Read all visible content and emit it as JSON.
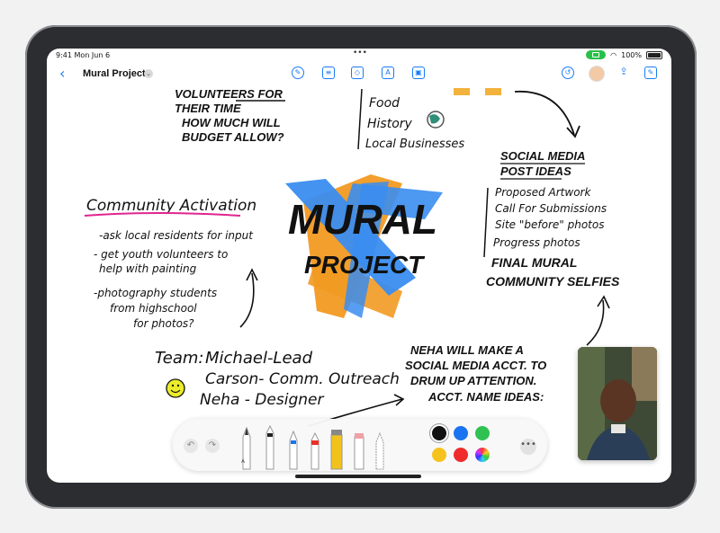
{
  "status_bar": {
    "time": "9:41",
    "date": "Mon Jun 6",
    "battery": "100%"
  },
  "toolbar": {
    "title": "Mural Project",
    "back_glyph": "‹",
    "chevron_glyph": "⌄",
    "more_dots": "•••"
  },
  "notes": {
    "volunteers": [
      "VOLUNTEERS FOR",
      "THEIR TIME",
      "HOW MUCH WILL",
      "BUDGET ALLOW?"
    ],
    "list_top": [
      "Food",
      "History",
      "Local Businesses"
    ],
    "community_heading": "Community Activation",
    "community_items": [
      "-ask local residents for input",
      "- get youth volunteers to",
      "help with painting",
      "-photography students",
      "from highschool",
      "for photos?"
    ],
    "mural_title": [
      "MURAL",
      "PROJECT"
    ],
    "social_heading": [
      "SOCIAL MEDIA",
      "POST IDEAS"
    ],
    "social_items": [
      "Proposed Artwork",
      "Call For Submissions",
      "Site \"before\" photos",
      "Progress photos"
    ],
    "social_bold": [
      "FINAL MURAL",
      "COMMUNITY SELFIES"
    ],
    "team_heading": "Team:",
    "team_items": [
      "Michael-Lead",
      "Carson- Comm. Outreach",
      "Neha - Designer"
    ],
    "neha_note": [
      "NEHA WILL MAKE A",
      "SOCIAL MEDIA ACCT. TO",
      "DRUM UP ATTENTION.",
      "ACCT. NAME IDEAS:"
    ]
  },
  "palette": {
    "undo_glyph": "↶",
    "redo_glyph": "↷",
    "more_glyph": "•••",
    "tool_label": "A",
    "colors": [
      "#111111",
      "#1a73f0",
      "#2fc252",
      "#f6c21c",
      "#ef2b2b"
    ]
  },
  "colors": {
    "accent": "#1a7cf5",
    "highlight": "#e0258f",
    "mural_blue": "#3a8df0",
    "mural_orange": "#f29a22"
  }
}
